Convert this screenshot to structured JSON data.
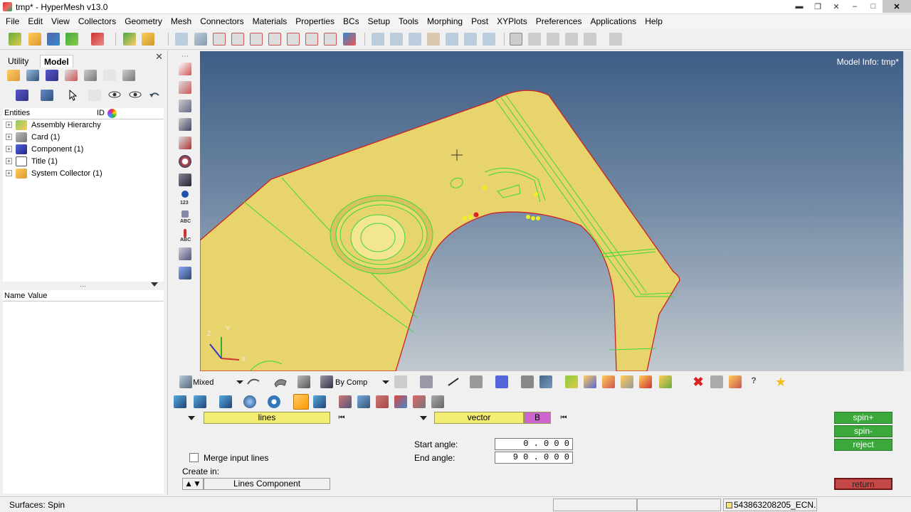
{
  "window": {
    "title": "tmp* - HyperMesh v13.0"
  },
  "menu": [
    "File",
    "Edit",
    "View",
    "Collectors",
    "Geometry",
    "Mesh",
    "Connectors",
    "Materials",
    "Properties",
    "BCs",
    "Setup",
    "Tools",
    "Morphing",
    "Post",
    "XYPlots",
    "Preferences",
    "Applications",
    "Help"
  ],
  "browser": {
    "tabs": [
      "Utility",
      "Model"
    ],
    "active_tab": "Model",
    "entities_header": "Entities",
    "id_header": "ID",
    "tree": [
      "Assembly Hierarchy",
      "Card (1)",
      "Component (1)",
      "Title (1)",
      "System Collector (1)"
    ],
    "name_header": "Name",
    "value_header": "Value",
    "splitter_grip": "⋯"
  },
  "viewport": {
    "model_info": "Model Info: tmp*",
    "axes": [
      "Z",
      "Y",
      "X"
    ]
  },
  "vstrip_labels": [
    "123",
    "ABC",
    "ABC"
  ],
  "visualization": {
    "display_mode": "Mixed",
    "color_mode": "By Comp"
  },
  "panel": {
    "lines_selector": "lines",
    "vector_selector": "vector",
    "b_label": "B",
    "reset_glyph": "⏮",
    "merge_label": "Merge input lines",
    "create_in_label": "Create in:",
    "create_in_value": "Lines Component",
    "start_angle_label": "Start angle:",
    "start_angle_value": "0.000",
    "end_angle_label": "End angle:",
    "end_angle_value": "90.000",
    "buttons": {
      "spin_plus": "spin+",
      "spin_minus": "spin-",
      "reject": "reject",
      "return": "return"
    }
  },
  "status": {
    "text": "Surfaces: Spin",
    "include": "543863208205_ECN."
  },
  "colors": {
    "model_fill": "#e8d46c",
    "edge_red": "#d01f1f",
    "edge_green": "#39d839",
    "selector_yellow": "#f3ee73",
    "b_magenta": "#cc66cc",
    "button_green": "#3aa83a",
    "return_red": "#c44848"
  }
}
